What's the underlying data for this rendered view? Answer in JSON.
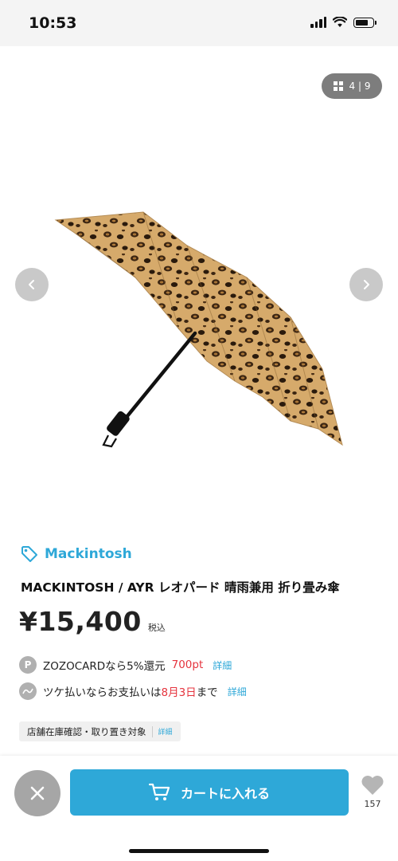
{
  "status_bar": {
    "time": "10:53"
  },
  "gallery": {
    "counter": "4 | 9",
    "current_index": 4,
    "total": 9
  },
  "product": {
    "brand": "Mackintosh",
    "title": "MACKINTOSH / AYR レオパード 晴雨兼用 折り畳み傘",
    "price": "¥15,400",
    "tax_label": "税込"
  },
  "zozocard": {
    "icon": "P",
    "text": "ZOZOCARDなら5%還元",
    "points": "700pt",
    "link": "詳細"
  },
  "tsuke": {
    "text_prefix": "ツケ払いならお支払いは",
    "date": "8月3日",
    "text_suffix": "まで",
    "link": "詳細"
  },
  "store_chip": {
    "label": "店舗在庫確認・取り置き対象",
    "link": "詳細"
  },
  "bottom": {
    "cart_label": "カートに入れる",
    "favorite_count": "157"
  },
  "colors": {
    "accent": "#2ea8d8",
    "red": "#e5333d",
    "gray_button": "#a6a6a6"
  }
}
